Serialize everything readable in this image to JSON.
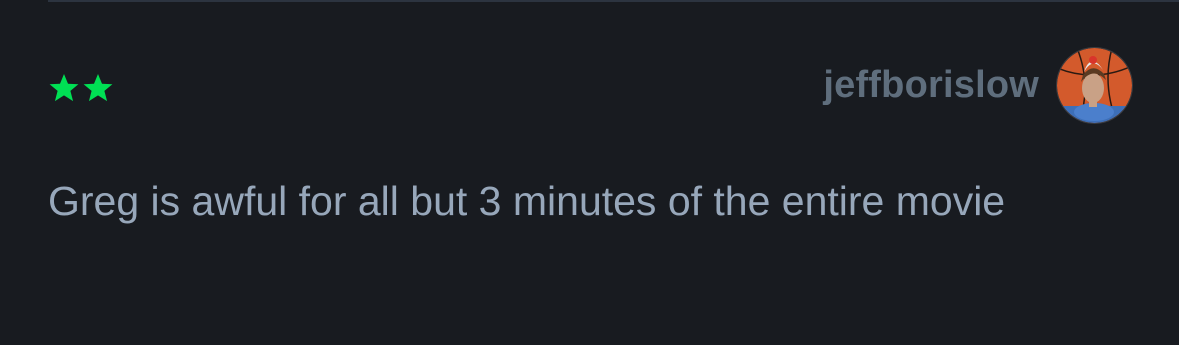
{
  "review": {
    "rating": 2,
    "max_rating": 5,
    "username": "jeffborislow",
    "text": "Greg is awful for all but 3 minutes of the entire movie"
  },
  "colors": {
    "background": "#181b20",
    "star": "#00e054",
    "username": "#5f6e7d",
    "body_text": "#97a7ba",
    "divider": "#2c3440"
  },
  "icons": {
    "star": "star-icon",
    "avatar": "avatar-image"
  }
}
